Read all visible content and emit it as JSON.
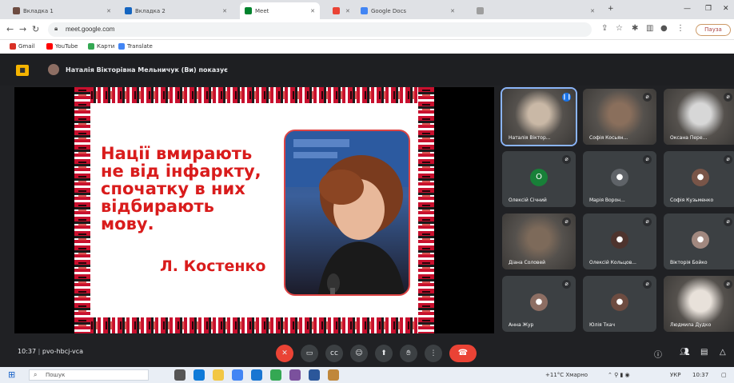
{
  "browser": {
    "tabs": [
      {
        "title": "Вкладка 1",
        "favicon_color": "#6d4c41",
        "active": false
      },
      {
        "title": "Вкладка 2",
        "favicon_color": "#1565c0",
        "active": false
      },
      {
        "title": "Meet",
        "favicon_color": "#00832d",
        "active": true
      },
      {
        "title": "",
        "favicon_color": "#ea4335",
        "active": false
      },
      {
        "title": "Google Docs",
        "favicon_color": "#4285f4",
        "active": false
      },
      {
        "title": "",
        "favicon_color": "#9e9e9e",
        "active": false
      }
    ],
    "url": "meet.google.com",
    "pause_label": "Пауза"
  },
  "bookmarks": [
    {
      "label": "Gmail",
      "color": "#d93025"
    },
    {
      "label": "YouTube",
      "color": "#ff0000"
    },
    {
      "label": "Карти",
      "color": "#34a853"
    },
    {
      "label": "Translate",
      "color": "#4285f4"
    }
  ],
  "meet": {
    "presenter_label": "Наталія Вікторівна Мельничук (Ви) показує",
    "slide": {
      "quote_lines": [
        "Нації вмирають",
        "не від інфаркту,",
        "спочатку в них",
        "відбирають",
        "мову."
      ],
      "author": "Л. Костенко"
    },
    "participants": [
      {
        "name": "Наталія Віктор...",
        "type": "video",
        "active": true,
        "mic": "on",
        "tone": "#c9b8a6"
      },
      {
        "name": "Софія Косьян...",
        "type": "video",
        "active": false,
        "mic": "off",
        "tone": "#8a6f5c"
      },
      {
        "name": "Оксана Пере...",
        "type": "video",
        "active": false,
        "mic": "off",
        "tone": "#d7d7d7"
      },
      {
        "name": "Олексій Січний",
        "type": "avatar",
        "initial": "O",
        "avatar_color": "#188038",
        "mic": "off"
      },
      {
        "name": "Марія Ворон...",
        "type": "avatar",
        "initial": "●",
        "avatar_color": "#5f6368",
        "mic": "off"
      },
      {
        "name": "Софія Кузьменко",
        "type": "avatar",
        "initial": "●",
        "avatar_color": "#795548",
        "mic": "off"
      },
      {
        "name": "Діана Соловей",
        "type": "video",
        "active": false,
        "mic": "off",
        "tone": "#7d6a5a"
      },
      {
        "name": "Олексій Кольцов...",
        "type": "avatar",
        "initial": "●",
        "avatar_color": "#4e342e",
        "mic": "off"
      },
      {
        "name": "Вікторія Бойко",
        "type": "avatar",
        "initial": "●",
        "avatar_color": "#a1887f",
        "mic": "off"
      },
      {
        "name": "Анна Жур",
        "type": "avatar",
        "initial": "●",
        "avatar_color": "#8d6e63",
        "mic": "off"
      },
      {
        "name": "Юлія Ткач",
        "type": "avatar",
        "initial": "●",
        "avatar_color": "#6d4c41",
        "mic": "off"
      },
      {
        "name": "Людмила Дудко",
        "type": "video",
        "active": false,
        "mic": "off",
        "tone": "#e8e1da"
      }
    ],
    "clock": "10:37",
    "meeting_code": "pvo-hbcj-vca",
    "controls": [
      "mic",
      "camera",
      "captions",
      "raise-hand",
      "present",
      "reactions",
      "more"
    ]
  },
  "taskbar": {
    "search_placeholder": "Пошук",
    "apps": [
      {
        "name": "task-view",
        "color": "#555"
      },
      {
        "name": "edge",
        "color": "#0f7ad8"
      },
      {
        "name": "explorer",
        "color": "#f2c744"
      },
      {
        "name": "store",
        "color": "#4285f4"
      },
      {
        "name": "mail",
        "color": "#1976d2"
      },
      {
        "name": "chrome",
        "color": "#34a853"
      },
      {
        "name": "viber",
        "color": "#7b519d"
      },
      {
        "name": "word",
        "color": "#2b579a"
      },
      {
        "name": "app",
        "color": "#c0873b"
      }
    ],
    "weather": "+11°C Хмарно",
    "lang": "УКР",
    "time": "10:37"
  }
}
